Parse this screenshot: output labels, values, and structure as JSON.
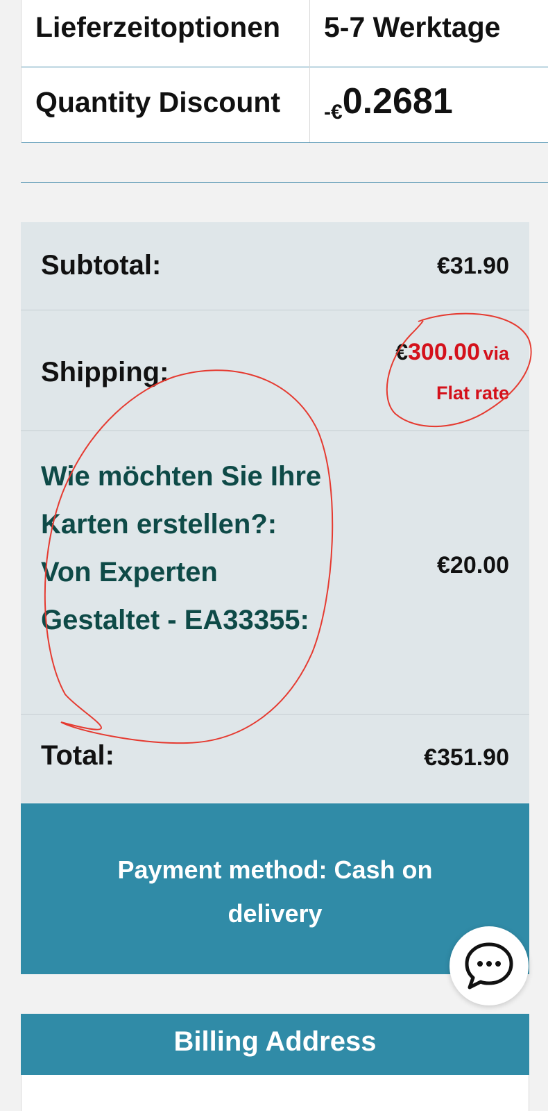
{
  "product_meta": {
    "rows": [
      {
        "label": "Lieferzeitoptionen",
        "value": "5-7 Werktage"
      },
      {
        "label": "Quantity Discount",
        "value_prefix": "-€",
        "value_number": "0.2681"
      }
    ]
  },
  "totals": {
    "subtotal": {
      "label": "Subtotal:",
      "value": "€31.90"
    },
    "shipping": {
      "label": "Shipping:",
      "currency": "€",
      "amount": "300.00",
      "via": "via",
      "method": "Flat rate"
    },
    "option": {
      "label": "Wie möchten Sie Ihre Karten erstellen?: Von Experten Gestaltet - EA33355:",
      "value": "€20.00"
    },
    "total": {
      "label": "Total:",
      "value": "€351.90"
    }
  },
  "payment": {
    "text": "Payment method: Cash on delivery"
  },
  "billing": {
    "title": "Billing Address"
  },
  "chat": {
    "icon": "chat-bubble-icon"
  },
  "colors": {
    "accent": "#308ba7",
    "totals_bg": "#dfe6e9",
    "shipping_highlight": "#d4111b",
    "option_text": "#0e4a47",
    "annotation": "#e53a30"
  }
}
